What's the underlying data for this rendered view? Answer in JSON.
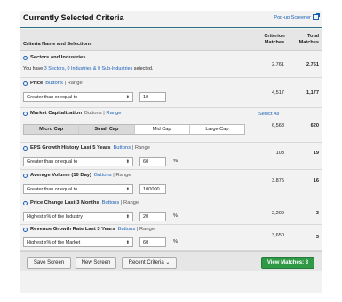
{
  "panel": {
    "title": "Currently Selected Criteria",
    "popup_label": "Pop-up Screener"
  },
  "header": {
    "col1": "Criteria Name and Selections",
    "col2_l1": "Criterion",
    "col2_l2": "Matches",
    "col3_l1": "Total",
    "col3_l2": "Matches"
  },
  "sectors": {
    "title": "Sectors and Industries",
    "text_prefix": "You have ",
    "text_link": "3 Sectors, 0 Industries & 0 Sub-Industries",
    "text_suffix": " selected.",
    "criterion": "2,761",
    "total": "2,761"
  },
  "price": {
    "title": "Price",
    "link_buttons": "Buttons",
    "sep": " | ",
    "link_range": "Range",
    "select": "Greater than or equal to",
    "value": "10",
    "criterion": "4,517",
    "total": "1,177"
  },
  "mcap": {
    "title": "Market Capitalization",
    "link_buttons": "Buttons",
    "sep": " | ",
    "link_range": "Range",
    "select_all": "Select All",
    "segments": [
      "Micro Cap",
      "Small Cap",
      "Mid Cap",
      "Large Cap"
    ],
    "criterion": "6,568",
    "total": "620"
  },
  "eps": {
    "title": "EPS Growth History Last 5 Years",
    "link_buttons": "Buttons",
    "sep": " | ",
    "link_range": "Range",
    "select": "Greater than or equal to",
    "value": "60",
    "unit": "%",
    "criterion": "108",
    "total": "19"
  },
  "volume": {
    "title": "Average Volume (10 Day)",
    "link_buttons": "Buttons",
    "sep": " | ",
    "link_range": "Range",
    "select": "Greater than or equal to",
    "value": "100000",
    "criterion": "3,875",
    "total": "16"
  },
  "pricechg": {
    "title": "Price Change Last 3 Months",
    "link_buttons": "Buttons",
    "sep": " | ",
    "link_range": "Range",
    "select": "Highest x% of the Industry",
    "value": "20",
    "unit": "%",
    "criterion": "2,209",
    "total": "3"
  },
  "revenue": {
    "title": "Revenue Growth Rate Last 3 Years",
    "link_buttons": "Buttons",
    "sep": " | ",
    "link_range": "Range",
    "select": "Highest x% of the Market",
    "value": "60",
    "unit": "%",
    "criterion": "3,650",
    "total": "3"
  },
  "footer": {
    "save": "Save Screen",
    "new": "New Screen",
    "recent": "Recent Criteria",
    "view": "View Matches: 3"
  }
}
